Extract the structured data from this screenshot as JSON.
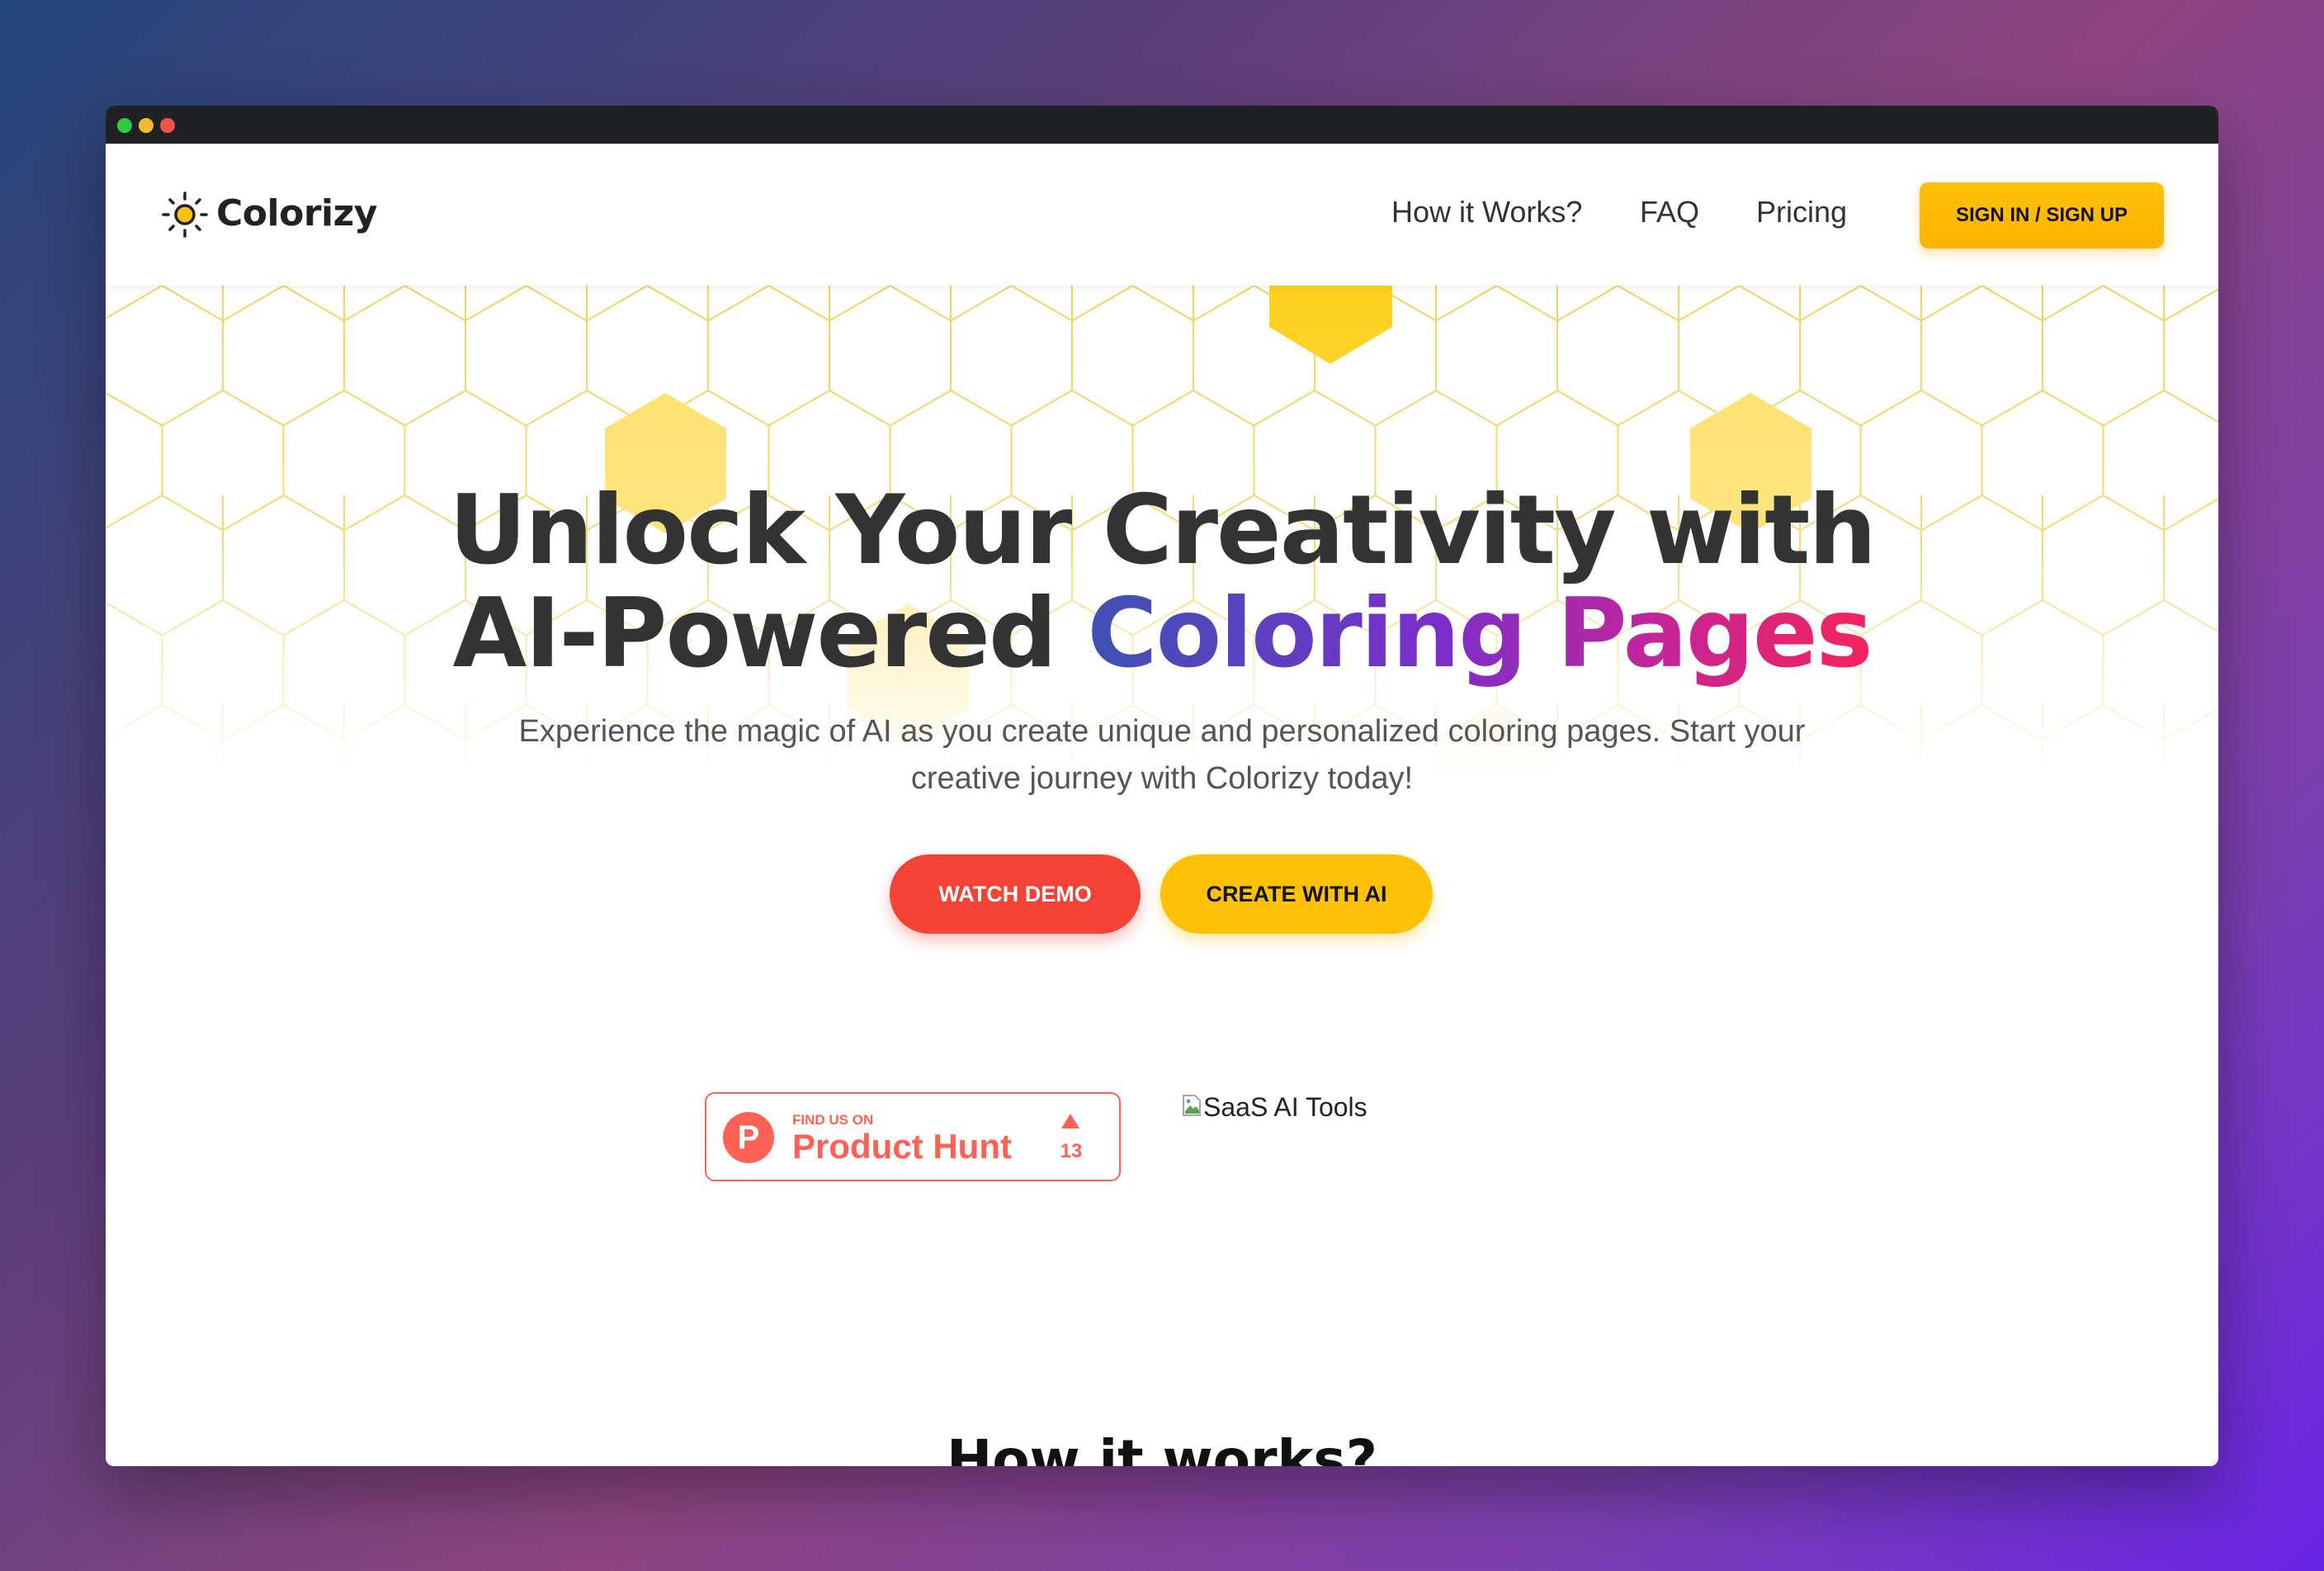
{
  "brand": {
    "name": "Colorizy"
  },
  "nav": {
    "links": [
      {
        "label": "How it Works?"
      },
      {
        "label": "FAQ"
      },
      {
        "label": "Pricing"
      }
    ],
    "signin_label": "SIGN IN / SIGN UP"
  },
  "hero": {
    "title_line1": "Unlock Your Creativity with",
    "title_line2_plain": "AI-Powered ",
    "title_line2_gradient": "Coloring Pages",
    "subtitle": "Experience the magic of AI as you create unique and personalized coloring pages. Start your creative journey with Colorizy today!",
    "watch_demo_label": "WATCH DEMO",
    "create_label": "CREATE WITH AI"
  },
  "badges": {
    "product_hunt": {
      "small": "FIND US ON",
      "big": "Product Hunt",
      "logo_letter": "P",
      "count": "13"
    },
    "saas_alt": "SaaS AI Tools"
  },
  "section": {
    "title": "How it works?"
  },
  "colors": {
    "accent_yellow": "#ffc107",
    "accent_red": "#f44336",
    "producthunt": "#ff6154",
    "text_dark": "#333333"
  },
  "icons": [
    "sun-logo-icon",
    "upvote-arrow-icon",
    "broken-image-icon"
  ]
}
